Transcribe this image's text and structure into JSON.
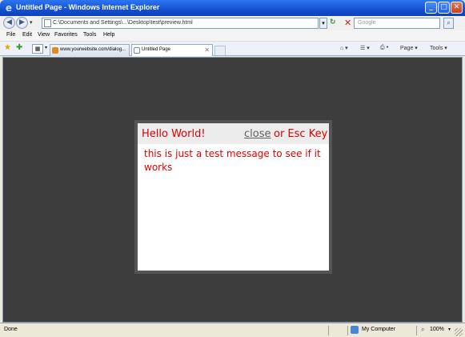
{
  "window": {
    "title": "Untitled Page - Windows Internet Explorer",
    "min_label": "_",
    "max_label": "□",
    "close_label": "✕"
  },
  "addressbar": {
    "url": "C:\\Documents and Settings\\...\\Desktop\\test\\preview.html",
    "search_placeholder": "Google"
  },
  "menu": {
    "items": [
      "File",
      "Edit",
      "View",
      "Favorites",
      "Tools",
      "Help"
    ]
  },
  "tabs": [
    {
      "label": "www.yourwebsite.com/dialog..."
    },
    {
      "label": "Untitled Page"
    }
  ],
  "commandbar": {
    "home": "⌂ ▾",
    "feeds": "☰ ▾",
    "print": "⎙ ▾",
    "page": "Page ▾",
    "tools": "Tools ▾"
  },
  "modal": {
    "title": "Hello World!",
    "close_link": "close",
    "close_suffix": "or Esc Key",
    "message": "this is just a test message to see if it works"
  },
  "statusbar": {
    "text": "Done",
    "zone": "My Computer",
    "zoom": "100%"
  },
  "colors": {
    "overlay": "#3d3d3d",
    "modal_text": "#e00000",
    "titlebar": "#1450d0"
  }
}
